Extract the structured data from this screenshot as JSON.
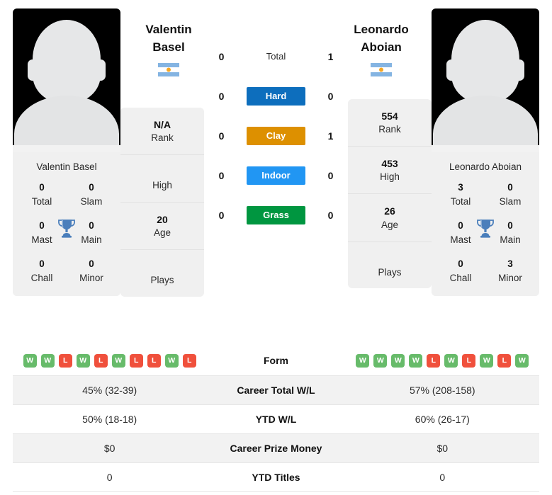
{
  "players": {
    "left": {
      "first_name": "Valentin",
      "last_name": "Basel",
      "full_name": "Valentin Basel",
      "flag": "argentina-flag",
      "avatar": "player-photo-placeholder",
      "stat_card": [
        {
          "value": "N/A",
          "label": "Rank"
        },
        {
          "value": "",
          "label": "High"
        },
        {
          "value": "20",
          "label": "Age"
        },
        {
          "value": "",
          "label": "Plays"
        }
      ],
      "titles": [
        {
          "value": "0",
          "label": "Total"
        },
        {
          "value": "0",
          "label": "Slam"
        },
        {
          "value": "0",
          "label": "Mast"
        },
        {
          "value": "0",
          "label": "Main"
        },
        {
          "value": "0",
          "label": "Chall"
        },
        {
          "value": "0",
          "label": "Minor"
        }
      ],
      "form": [
        "W",
        "W",
        "L",
        "W",
        "L",
        "W",
        "L",
        "L",
        "W",
        "L"
      ],
      "career_total_wl": "45% (32-39)",
      "ytd_wl": "50% (18-18)",
      "career_prize_money": "$0",
      "ytd_titles": "0"
    },
    "right": {
      "first_name": "Leonardo",
      "last_name": "Aboian",
      "full_name": "Leonardo Aboian",
      "flag": "argentina-flag",
      "avatar": "player-photo-placeholder",
      "stat_card": [
        {
          "value": "554",
          "label": "Rank"
        },
        {
          "value": "453",
          "label": "High"
        },
        {
          "value": "26",
          "label": "Age"
        },
        {
          "value": "",
          "label": "Plays"
        }
      ],
      "titles": [
        {
          "value": "3",
          "label": "Total"
        },
        {
          "value": "0",
          "label": "Slam"
        },
        {
          "value": "0",
          "label": "Mast"
        },
        {
          "value": "0",
          "label": "Main"
        },
        {
          "value": "0",
          "label": "Chall"
        },
        {
          "value": "3",
          "label": "Minor"
        }
      ],
      "form": [
        "W",
        "W",
        "W",
        "W",
        "L",
        "W",
        "L",
        "W",
        "L",
        "W"
      ],
      "career_total_wl": "57% (208-158)",
      "ytd_wl": "60% (26-17)",
      "career_prize_money": "$0",
      "ytd_titles": "0"
    }
  },
  "head_to_head": {
    "rows": [
      {
        "label": "Total",
        "left": "0",
        "right": "1",
        "style": "plain",
        "color": ""
      },
      {
        "label": "Hard",
        "left": "0",
        "right": "0",
        "style": "pill",
        "color": "#0d6ebd"
      },
      {
        "label": "Clay",
        "left": "0",
        "right": "1",
        "style": "pill",
        "color": "#dd9000"
      },
      {
        "label": "Indoor",
        "left": "0",
        "right": "0",
        "style": "pill",
        "color": "#2196f3"
      },
      {
        "label": "Grass",
        "left": "0",
        "right": "0",
        "style": "pill",
        "color": "#009640"
      }
    ]
  },
  "table": {
    "rows": [
      {
        "label": "Form",
        "type": "form",
        "left": "",
        "right": ""
      },
      {
        "label": "Career Total W/L",
        "type": "text",
        "left": "45% (32-39)",
        "right": "57% (208-158)"
      },
      {
        "label": "YTD W/L",
        "type": "text",
        "left": "50% (18-18)",
        "right": "60% (26-17)"
      },
      {
        "label": "Career Prize Money",
        "type": "text",
        "left": "$0",
        "right": "$0"
      },
      {
        "label": "YTD Titles",
        "type": "text",
        "left": "0",
        "right": "0"
      }
    ]
  },
  "colors": {
    "win": "#67bb6a",
    "loss": "#f0503c",
    "trophy": "#4a7ebb",
    "card_bg": "#f0f0f0",
    "row_alt": "#f2f2f2"
  },
  "icons": {
    "trophy": "trophy-icon",
    "flag": "argentina-flag-icon"
  }
}
